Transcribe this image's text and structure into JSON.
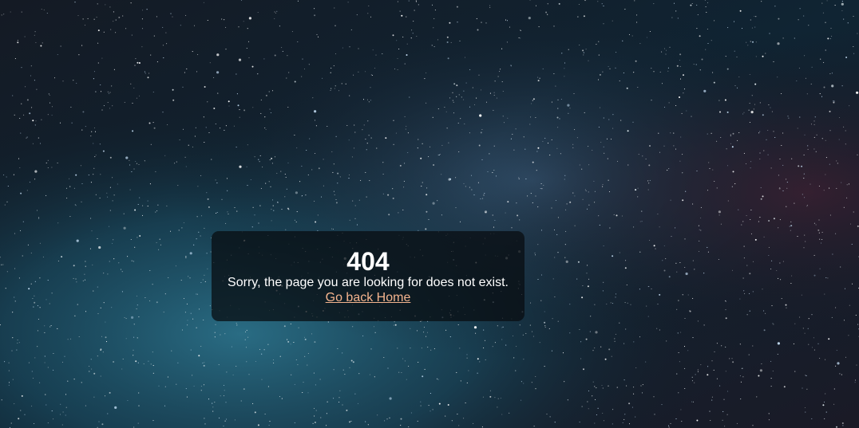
{
  "error": {
    "code": "404",
    "message": "Sorry, the page you are looking for does not exist.",
    "link_label": "Go back Home"
  },
  "colors": {
    "text": "#ffffff",
    "link": "#f4b48e",
    "panel": "#080c10",
    "sky_dark": "#0e1a24",
    "sky_teal": "#1d4f63",
    "sky_purple": "#2a1b2b"
  }
}
